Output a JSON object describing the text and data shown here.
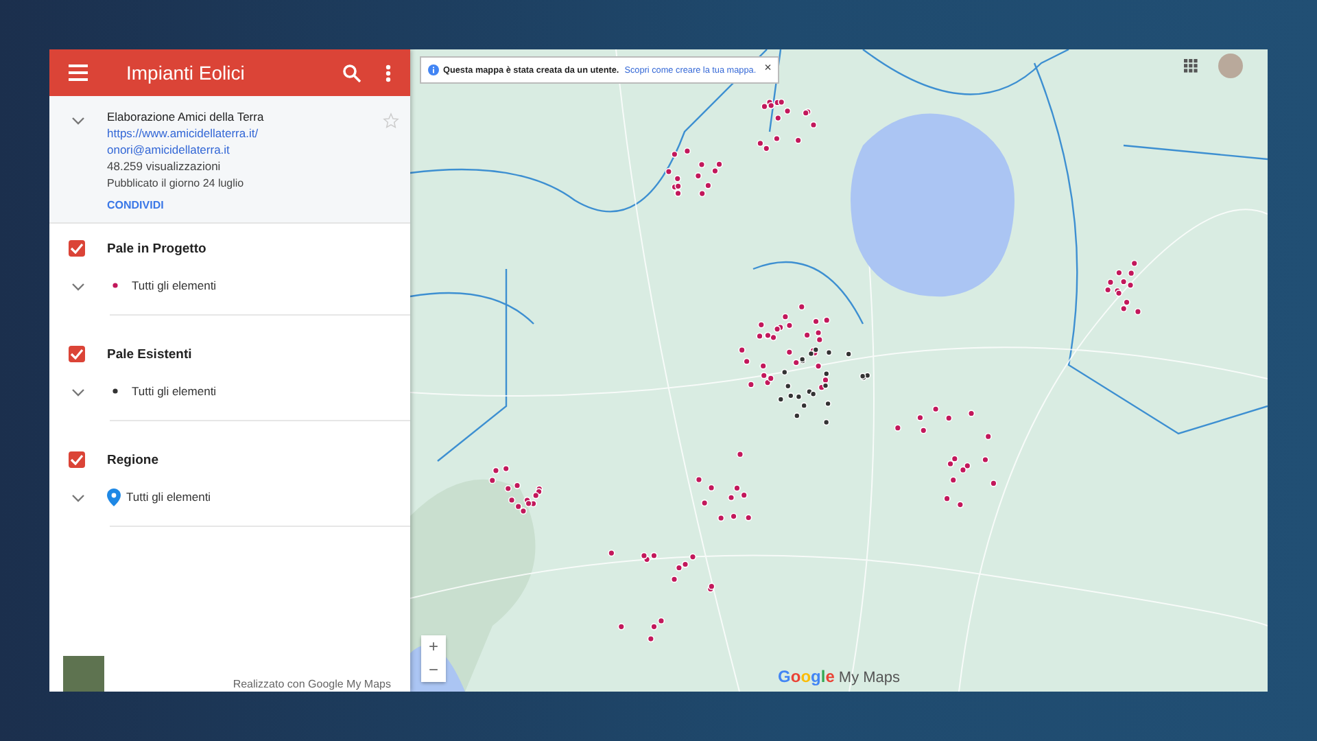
{
  "header": {
    "title": "Impianti Eolici"
  },
  "info": {
    "author": "Elaborazione Amici della Terra",
    "website": "https://www.amicidellaterra.it/",
    "email": "onori@amicidellaterra.it",
    "views": "48.259 visualizzazioni",
    "published": "Pubblicato il giorno 24 luglio",
    "share": "CONDIVIDI",
    "starred": false
  },
  "layers": [
    {
      "name": "Pale in Progetto",
      "checked": true,
      "items": "Tutti gli elementi",
      "kind": "dot",
      "color": "#c2185b"
    },
    {
      "name": "Pale Esistenti",
      "checked": true,
      "items": "Tutti gli elementi",
      "kind": "dot",
      "color": "#333333"
    },
    {
      "name": "Regione",
      "checked": true,
      "items": "Tutti gli elementi",
      "kind": "pin",
      "color": "#1e88e5"
    }
  ],
  "footer": {
    "credit": "Realizzato con Google My Maps"
  },
  "map": {
    "notice": "Questa mappa è stata creata da un utente.",
    "notice_link": "Scopri come creare la tua mappa.",
    "close": "×",
    "zoom_in": "+",
    "zoom_out": "−",
    "logo_google": "Google",
    "logo_suffix": "My Maps"
  }
}
